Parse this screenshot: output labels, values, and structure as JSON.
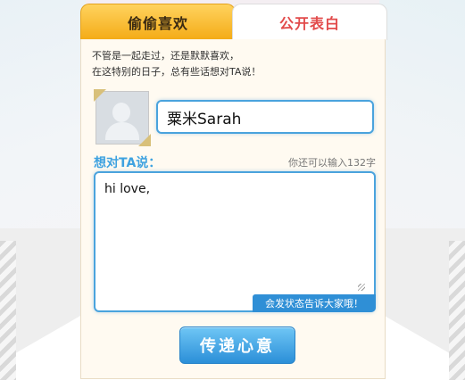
{
  "tabs": {
    "secret_label": "偷偷喜欢",
    "public_label": "公开表白"
  },
  "intro": {
    "line1": "不管是一起走过，还是默默喜欢，",
    "line2": "在这特别的日子，总有些话想对TA说！"
  },
  "recipient": {
    "name_value": "粟米Sarah"
  },
  "message": {
    "label": "想对TA说：",
    "remaining_text": "你还可以输入132字",
    "value": "hi love,",
    "status_notice": "会发状态告诉大家哦！"
  },
  "actions": {
    "send_label": "传递心意"
  },
  "colors": {
    "accent_blue": "#3ea2e0",
    "tab_active": "#f4ab16",
    "tab_public_text": "#e24b4b"
  },
  "icons": {
    "avatar": "default-avatar-icon"
  }
}
